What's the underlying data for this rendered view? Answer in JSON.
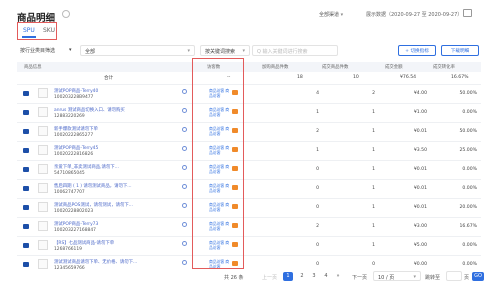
{
  "header": {
    "title": "商品明细",
    "channel_filter": "全部渠道",
    "date_label": "展示数据（2020-09-27 至 2020-09-27）"
  },
  "tabs": [
    {
      "label": "SPU",
      "active": true
    },
    {
      "label": "SKU",
      "active": false
    }
  ],
  "controls": {
    "category_select": "按行业类目筛选",
    "category_value": "全部",
    "tag_select": "按关键词搜索",
    "search_placeholder": "Q 输入关键词进行搜索",
    "compare_button": "+ 切换指标",
    "download_button": "下载明细"
  },
  "columns": [
    "商品信息",
    "访客数",
    "加购商品件数",
    "成交商品件数",
    "成交金额",
    "成交转化率"
  ],
  "summary": {
    "label": "合计",
    "visitors": "--",
    "cart": "18",
    "sold": "10",
    "amount": "¥76.54",
    "rate": "16.67%"
  },
  "rows": [
    {
      "name": "测试POP商品-Terry40",
      "code": "100203228B9477",
      "visitors_tag": "商品访客 商品访客",
      "cart": "4",
      "sold": "2",
      "amount": "¥4.00",
      "rate": "50.00%"
    },
    {
      "name": "anrus 测试商品切换入口、请勿购买",
      "code": "12883220269",
      "visitors_tag": "商品访客 商品访客",
      "cart": "1",
      "sold": "1",
      "amount": "¥1.00",
      "rate": "0.00%"
    },
    {
      "name": "新手爆款测试请勿下单",
      "code": "10020222865277",
      "visitors_tag": "商品访客 商品访客",
      "cart": "2",
      "sold": "1",
      "amount": "¥0.01",
      "rate": "50.00%"
    },
    {
      "name": "测试POP商品-Terry45",
      "code": "10020222816826",
      "visitors_tag": "商品访客 商品访客",
      "cart": "1",
      "sold": "1",
      "amount": "¥3.50",
      "rate": "25.00%"
    },
    {
      "name": "亲爱下单_非卖测试商品,请勿下...",
      "code": "54710865045",
      "visitors_tag": "商品访客 商品访客",
      "cart": "0",
      "sold": "1",
      "amount": "¥0.01",
      "rate": "0.00%"
    },
    {
      "name": "售后四期 ( 1 ) 请勿测试商品，请勿下...",
      "code": "10062747707",
      "visitors_tag": "商品访客 商品访客",
      "cart": "0",
      "sold": "1",
      "amount": "¥0.01",
      "rate": "0.00%"
    },
    {
      "name": "测试商品POS测试，请勿测试，请勿下...",
      "code": "10020228802023",
      "visitors_tag": "商品访客 商品访客",
      "cart": "0",
      "sold": "1",
      "amount": "¥0.01",
      "rate": "20.00%"
    },
    {
      "name": "测试POP商品-Terry73",
      "code": "100203227168847",
      "visitors_tag": "商品访客 商品访客",
      "cart": "2",
      "sold": "1",
      "amount": "¥3.00",
      "rate": "16.67%"
    },
    {
      "name": "【RS】七品测试商品-请勿下单",
      "code": "1268766119",
      "visitors_tag": "商品访客 商品访客",
      "cart": "0",
      "sold": "1",
      "amount": "¥5.00",
      "rate": "0.00%"
    },
    {
      "name": "测试测试商品请勿下单、无价格、请勿下...",
      "code": "12345659766",
      "visitors_tag": "商品访客 商品访客",
      "cart": "0",
      "sold": "0",
      "amount": "¥0.00",
      "rate": "0.00%"
    }
  ],
  "pagination": {
    "total": "共 26 条",
    "prev": "上一页",
    "pages": [
      "1",
      "2",
      "3",
      "4"
    ],
    "next": "下一页",
    "more": "»",
    "page_size": "10 / 页",
    "goto_label": "跳转至",
    "goto_value": "",
    "page_suffix": "页",
    "go_button": "GO"
  }
}
